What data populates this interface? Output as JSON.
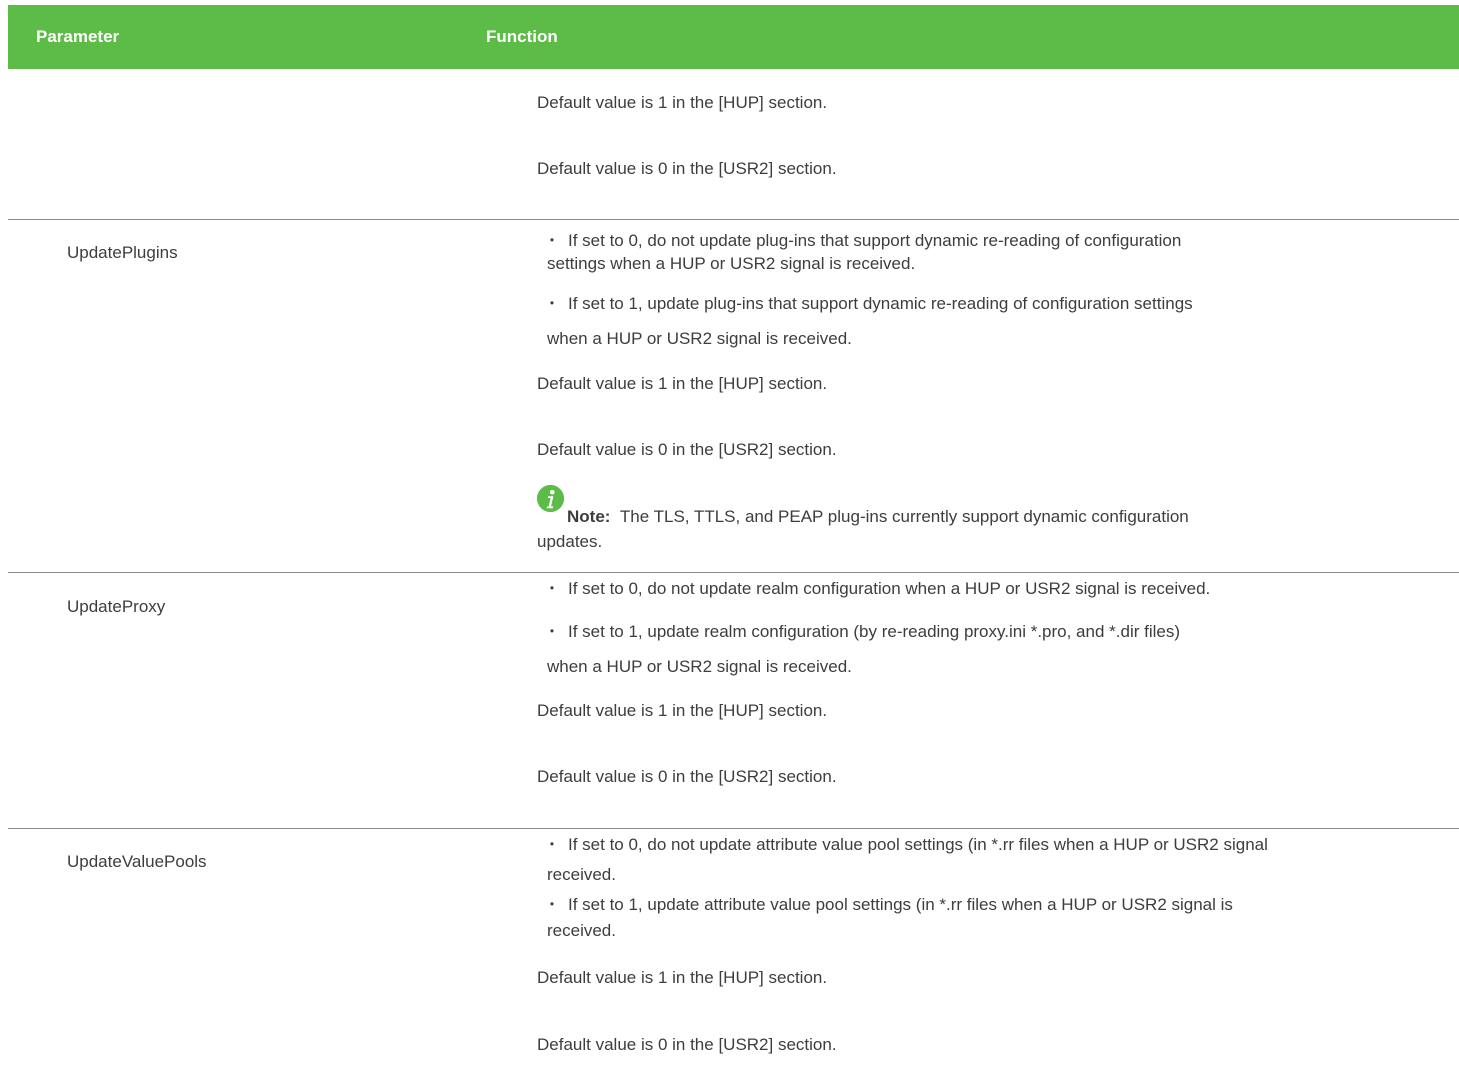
{
  "header": {
    "col_parameter": "Parameter",
    "col_function": "Function"
  },
  "row0": {
    "default_hup": "Default value is 1 in the [HUP] section.",
    "default_usr2": "Default value is 0 in the [USR2] section."
  },
  "rows": [
    {
      "parameter": "UpdatePlugins",
      "bullet1_line1": "If set to 0, do not update plug-ins that support dynamic re-reading of configuration",
      "bullet1_line2": "settings when a HUP or USR2 signal is received.",
      "bullet2_line1": "If set to 1, update plug-ins that support dynamic re-reading of configuration settings",
      "bullet2_line2": "when a HUP or USR2 signal is received.",
      "default_hup": "Default value is 1 in the [HUP] section.",
      "default_usr2": "Default value is 0 in the [USR2] section.",
      "note_label": "Note:",
      "note_text_line1": "The TLS, TTLS, and PEAP plug-ins currently support dynamic configuration",
      "note_text_line2": "updates."
    },
    {
      "parameter": "UpdateProxy",
      "bullet1_line1": "If set to 0, do not update realm configuration when a HUP or USR2 signal is received.",
      "bullet2_line1": "If set to 1, update realm configuration (by re-reading proxy.ini  *.pro, and *.dir files)",
      "bullet2_line2": "when a HUP or USR2 signal is received.",
      "default_hup": "Default value is 1 in the [HUP] section.",
      "default_usr2": "Default value is 0 in the [USR2] section."
    },
    {
      "parameter": "UpdateValuePools",
      "bullet1_line1": "If set to 0, do not update attribute value pool settings (in *.rr files when a HUP or USR2 signal",
      "bullet1_line2": "received.",
      "bullet2_line1": "If set to 1, update attribute value pool settings (in *.rr files when a HUP or USR2 signal is",
      "bullet2_line2": "received.",
      "default_hup": "Default value is 1 in the [HUP] section.",
      "default_usr2": "Default value is 0 in the [USR2] section."
    }
  ],
  "bullet_glyph": "•",
  "colors": {
    "header_bg": "#5dbb47",
    "header_text": "#ffffff",
    "body_text": "#3d3d3d",
    "divider": "#8a8a8a",
    "note_icon": "#5dbb47"
  },
  "icons": {
    "note": "info-icon"
  }
}
